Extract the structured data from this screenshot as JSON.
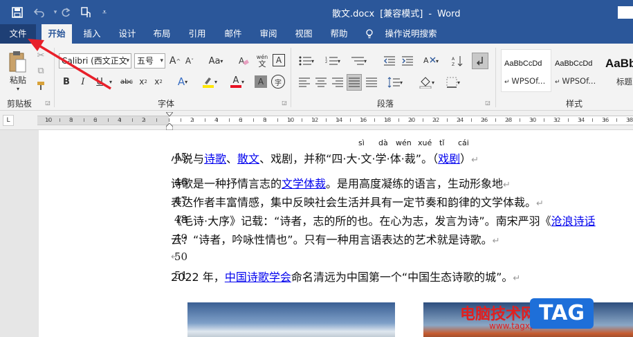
{
  "titlebar": {
    "doc_name": "散文.docx",
    "mode": "[兼容模式]",
    "sep": "-",
    "app": "Word",
    "qat": {
      "save": "save-icon",
      "undo": "undo-icon",
      "redo": "redo-icon",
      "touch": "touch-mode-icon",
      "more": "customize-qat-icon"
    }
  },
  "tabs": [
    "文件",
    "开始",
    "插入",
    "设计",
    "布局",
    "引用",
    "邮件",
    "审阅",
    "视图",
    "帮助",
    "操作说明搜索"
  ],
  "ribbon": {
    "clipboard": {
      "paste": "粘贴",
      "label": "剪贴板"
    },
    "font": {
      "name": "Calibri (西文正文",
      "size": "五号",
      "label": "字体",
      "grow": "A",
      "shrink": "A",
      "case": "Aa",
      "phonetic_top": "wén",
      "phonetic_bottom": "文",
      "border_char": "A",
      "bold": "B",
      "italic": "I",
      "underline": "U",
      "strike": "abc",
      "sub": "x",
      "sup": "x",
      "effects": "A",
      "font_color": "A",
      "shading": "A",
      "enclose": "字"
    },
    "paragraph": {
      "label": "段落"
    },
    "styles": {
      "label": "样式",
      "items": [
        {
          "preview": "AaBbCcDd",
          "name": "WPSOf..."
        },
        {
          "preview": "AaBbCcDd",
          "name": "WPSOf..."
        },
        {
          "preview": "AaBb",
          "name": "标题"
        }
      ]
    }
  },
  "ruler": {
    "numbers": [
      "10",
      "8",
      "6",
      "4",
      "2",
      "2",
      "4",
      "6",
      "8",
      "10",
      "12",
      "14",
      "16",
      "18",
      "20",
      "22",
      "24",
      "26",
      "28",
      "30",
      "32",
      "34",
      "36",
      "38"
    ]
  },
  "document": {
    "lines": [
      {
        "num": "45",
        "parts": [
          {
            "t": "小说与"
          },
          {
            "t": "诗歌",
            "link": true
          },
          {
            "t": "、"
          },
          {
            "t": "散文",
            "link": true
          },
          {
            "t": "、戏剧，并称“四·大·文·学·体·裁”。（"
          },
          {
            "t": "戏剧",
            "link": true
          },
          {
            "t": "）"
          }
        ],
        "pm": "↵",
        "ruby": [
          "sì",
          "dà",
          "wén",
          "xué",
          "tǐ",
          "cái"
        ]
      },
      {
        "num": "46",
        "parts": [
          {
            "t": "诗歌是一种抒情言志的"
          },
          {
            "t": "文学体裁",
            "link": true
          },
          {
            "t": "。是用高度凝练的语言，生动形象地"
          }
        ],
        "pm": "↵"
      },
      {
        "num": "47",
        "parts": [
          {
            "t": "表达作者丰富情感，集中反映社会生活并具有一定节奏和韵律的文学体裁。"
          }
        ],
        "pm": "↵"
      },
      {
        "num": "48",
        "parts": [
          {
            "t": "《毛诗·大序》记载：“诗者，志的所的也。在心为志，发言为诗”。南宋严羽《"
          },
          {
            "t": "沧浪诗话",
            "link": true
          }
        ],
        "pm": ""
      },
      {
        "num": "49",
        "parts": [
          {
            "t": "云：“诗者，吟咏性情也”。只有一种用言语表达的艺术就是诗歌。"
          }
        ],
        "pm": "↵"
      },
      {
        "num": "50",
        "parts": [],
        "pm": "↵"
      },
      {
        "num": "51",
        "parts": [
          {
            "t": "2022 年，"
          },
          {
            "t": "中国诗歌学会",
            "link": true
          },
          {
            "t": "命名清远为中国第一个“中国生态诗歌的城”。"
          }
        ],
        "pm": "↵"
      }
    ]
  },
  "watermark": {
    "site_cn": "电脑技术网",
    "url": "www.tagxp.com",
    "tag": "TAG"
  },
  "colors": {
    "brand": "#2b579a",
    "arrow": "#e8202a",
    "link": "#0000ee"
  }
}
